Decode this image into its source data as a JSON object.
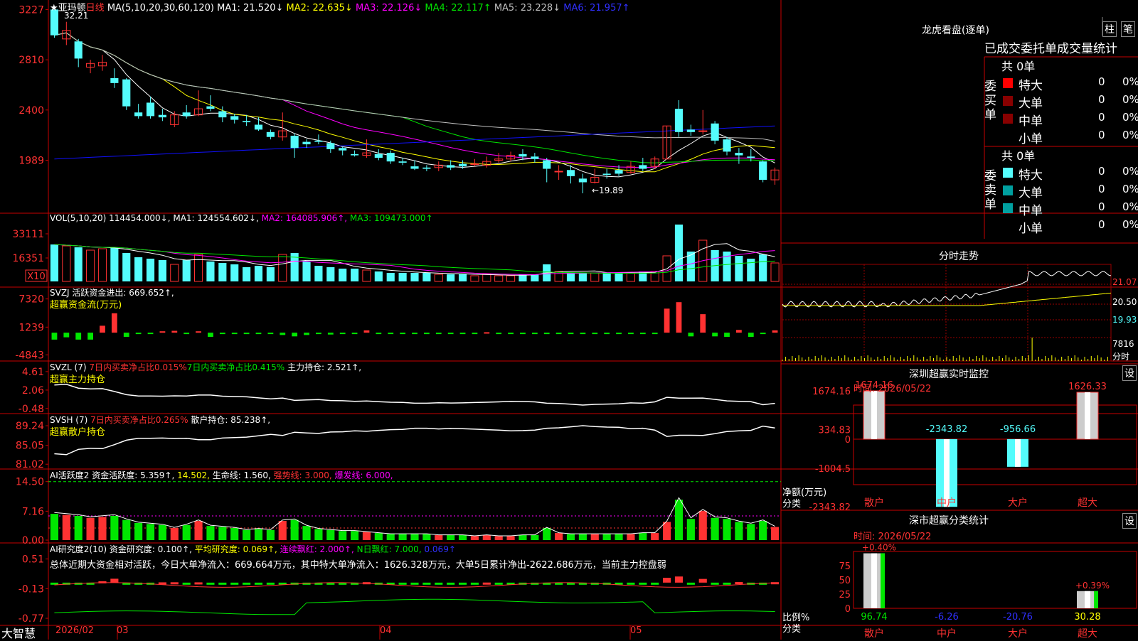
{
  "colors": {
    "up": "#ff3232",
    "down": "#54fcfc",
    "grid": "#9a0000",
    "axis": "#c80000",
    "ma1": "#ffffff",
    "ma2": "#ffff00",
    "ma3": "#ff00ff",
    "ma4": "#00e600",
    "ma5": "#c0c0c0",
    "ma6": "#1010ff",
    "green": "#00e600",
    "yellow": "#ffff00"
  },
  "header": {
    "stock": "★亚玛顿",
    "period": "日线",
    "ma_label": "MA(5,10,20,30,60,120)",
    "ma1": "MA1: 21.520↓",
    "ma2": "MA2: 22.635↓",
    "ma3": "MA3: 22.126↓",
    "ma4": "MA4: 22.117↑",
    "ma5": "MA5: 23.228↓",
    "ma6": "MA6: 21.957↑",
    "hi_note": "32.21",
    "lo_note": "←19.89"
  },
  "price_axis": [
    "3227",
    "2810",
    "2400",
    "1989"
  ],
  "vol": {
    "label": "VOL(5,10,20)",
    "val": "114454.000↓,",
    "ma1": "MA1: 124554.602↓,",
    "ma2": "MA2: 164085.906↑,",
    "ma3": "MA3: 109473.000↑",
    "axis": [
      "33111",
      "16351"
    ],
    "unit": "X10"
  },
  "svzj": {
    "label": "SVZJ  活跃资金进出: 669.652↑,",
    "sub": "超赢资金流(万元)",
    "axis": [
      "7320",
      "1239",
      "-4843"
    ]
  },
  "svzl": {
    "label": "SVZL (7)",
    "a": "7日内买卖净占比0.015%",
    "b": "7日内买卖净占比0.415%",
    "c": "主力持仓: 2.521↑,",
    "sub": "超赢主力持仓",
    "axis": [
      "4.61",
      "2.06",
      "-0.48"
    ]
  },
  "svsh": {
    "label": "SVSH (7)",
    "a": "7日内买卖净占比0.265%",
    "c": "散户持仓: 85.238↑,",
    "sub": "超赢散户持仓",
    "axis": [
      "89.24",
      "85.05",
      "81.02"
    ]
  },
  "ai1": {
    "label": "AI活跃度2",
    "a": "资金活跃度: 5.359↑,",
    "b": "14.502,",
    "c": "生命线: 1.560,",
    "d": "强势线: 3.000,",
    "e": "爆发线: 6.000,",
    "axis": [
      "14.50",
      "7.16",
      "0.00"
    ]
  },
  "ai2": {
    "label": "AI研究度2(10)",
    "a": "资金研究度: 0.100↑,",
    "b": "平均研究度: 0.069↑,",
    "c": "连续飘红: 2.000↑,",
    "d": "N日飘红: 7.000,",
    "e": "0.069↑",
    "summary": "总体近期大资金相对活跃，今日大单净流入：669.664万元，其中特大单净流入：1626.328万元，大单5日累计净出-2622.686万元，当前主力控盘弱",
    "axis": [
      "0.51",
      "-0.13",
      "-0.77"
    ]
  },
  "xaxis": {
    "logo": "大智慧",
    "d1": "2026/02",
    "d2": "03",
    "d3": "04",
    "d4": "05"
  },
  "right": {
    "title": "龙虎看盘(逐单)",
    "btn1": "柱",
    "btn2": "笔",
    "subtitle": "已成交委托单成交量统计",
    "buy_side": "委买单",
    "sell_side": "委卖单",
    "buy_total": "共 0单",
    "sell_total": "共 0单",
    "rows": [
      {
        "name": "特大",
        "v": "0",
        "p": "0%"
      },
      {
        "name": "大单",
        "v": "0",
        "p": "0%"
      },
      {
        "name": "中单",
        "v": "0",
        "p": "0%"
      },
      {
        "name": "小单",
        "v": "0",
        "p": "0%"
      }
    ],
    "fenshi": "分时走势",
    "fs_axis": [
      "21.07",
      "20.50",
      "19.93",
      "7816"
    ],
    "fs_unit": "分时",
    "monitor": "深圳超赢实时监控",
    "settings": "设",
    "date": "时间: 2026/05/22",
    "m_axis": [
      "1674.16",
      "334.83",
      "0",
      "-1004.5",
      "-2343.82"
    ],
    "m_unit": "净额(万元)",
    "cat_label": "分类",
    "cats": [
      "散户",
      "中户",
      "大户",
      "超大"
    ],
    "m_vals": [
      {
        "v": 1674.16,
        "t": "1674.16"
      },
      {
        "v": -2343.82,
        "t": "-2343.82"
      },
      {
        "v": -956.66,
        "t": "-956.66"
      },
      {
        "v": 1626.33,
        "t": "1626.33"
      }
    ],
    "stats": "深市超赢分类统计",
    "s_axis": [
      "75",
      "50",
      "25",
      "0"
    ],
    "s_unit": "比例%",
    "s_vals": [
      {
        "v": 96.74,
        "t": "96.74",
        "top": "+0.40%"
      },
      {
        "v": -6.26,
        "t": "-6.26",
        "top": ""
      },
      {
        "v": -20.76,
        "t": "-20.76",
        "top": ""
      },
      {
        "v": 30.28,
        "t": "30.28",
        "top": "+0.39%"
      }
    ]
  },
  "chart_data": {
    "type": "candlestick",
    "ylim": [
      19.89,
      32.21
    ],
    "candles": [
      [
        32.2,
        30.1,
        32.2,
        29.9
      ],
      [
        29.8,
        30.5,
        31.2,
        29.3
      ],
      [
        29.6,
        28.2,
        29.8,
        27.5
      ],
      [
        27.5,
        27.8,
        28.1,
        27.0
      ],
      [
        27.6,
        27.9,
        28.5,
        27.2
      ],
      [
        26.6,
        26.2,
        27.4,
        25.8
      ],
      [
        26.5,
        24.3,
        26.6,
        24.0
      ],
      [
        23.8,
        23.5,
        24.5,
        23.3
      ],
      [
        24.6,
        23.5,
        25.1,
        23.3
      ],
      [
        23.6,
        23.4,
        24.1,
        23.1
      ],
      [
        22.8,
        23.6,
        23.9,
        22.6
      ],
      [
        23.8,
        23.5,
        24.4,
        23.3
      ],
      [
        23.6,
        24.1,
        25.6,
        23.5
      ],
      [
        24.3,
        24.1,
        25.2,
        23.9
      ],
      [
        23.9,
        23.4,
        24.3,
        23.0
      ],
      [
        23.5,
        23.2,
        23.7,
        22.9
      ],
      [
        23.1,
        23.0,
        23.6,
        22.7
      ],
      [
        22.8,
        22.4,
        23.4,
        22.3
      ],
      [
        22.2,
        21.8,
        22.4,
        21.6
      ],
      [
        21.8,
        22.3,
        23.8,
        21.5
      ],
      [
        21.9,
        20.9,
        22.1,
        20.1
      ],
      [
        21.4,
        21.2,
        21.6,
        20.9
      ],
      [
        21.5,
        21.4,
        22.0,
        21.2
      ],
      [
        21.3,
        20.8,
        21.5,
        20.5
      ],
      [
        20.9,
        20.7,
        21.0,
        20.3
      ],
      [
        20.4,
        20.3,
        20.7,
        20.2
      ],
      [
        20.3,
        20.5,
        21.6,
        20.1
      ],
      [
        20.4,
        20.1,
        20.8,
        19.9
      ],
      [
        20.5,
        19.8,
        20.7,
        19.6
      ],
      [
        19.8,
        19.7,
        20.1,
        19.5
      ],
      [
        19.4,
        19.2,
        19.9,
        19.1
      ],
      [
        19.3,
        19.2,
        19.5,
        19.0
      ],
      [
        19.3,
        19.5,
        19.8,
        19.0
      ],
      [
        19.5,
        19.3,
        19.9,
        19.1
      ],
      [
        19.6,
        19.4,
        19.9,
        19.2
      ],
      [
        19.6,
        19.6,
        20.0,
        19.4
      ],
      [
        19.5,
        19.8,
        20.2,
        19.3
      ],
      [
        19.9,
        20.0,
        20.5,
        19.7
      ],
      [
        20.0,
        20.3,
        20.6,
        19.8
      ],
      [
        20.4,
        20.2,
        20.8,
        19.9
      ],
      [
        20.2,
        20.0,
        20.5,
        19.7
      ],
      [
        19.9,
        19.2,
        20.1,
        18.1
      ],
      [
        19.0,
        19.0,
        19.5,
        18.3
      ],
      [
        19.1,
        18.6,
        19.5,
        18.0
      ],
      [
        18.4,
        18.1,
        18.8,
        17.2
      ],
      [
        18.1,
        18.5,
        19.2,
        18.0
      ],
      [
        18.8,
        18.7,
        19.2,
        18.4
      ],
      [
        19.1,
        18.8,
        19.5,
        18.6
      ],
      [
        18.9,
        19.4,
        19.8,
        18.8
      ],
      [
        19.5,
        19.2,
        20.1,
        19.0
      ],
      [
        19.4,
        20.0,
        20.2,
        19.2
      ],
      [
        20.0,
        22.7,
        22.7,
        20.0
      ],
      [
        24.1,
        22.2,
        24.8,
        21.8
      ],
      [
        22.4,
        22.2,
        22.8,
        21.9
      ],
      [
        22.3,
        22.3,
        24.0,
        22.0
      ],
      [
        22.9,
        21.5,
        23.1,
        21.2
      ],
      [
        21.6,
        20.6,
        21.8,
        20.3
      ],
      [
        20.5,
        20.3,
        20.9,
        19.6
      ],
      [
        20.2,
        20.1,
        20.8,
        19.8
      ],
      [
        19.8,
        18.3,
        19.9,
        18.1
      ],
      [
        18.3,
        19.1,
        19.3,
        17.9
      ]
    ],
    "volume": [
      2.6,
      2.5,
      2.4,
      2.2,
      2.3,
      2.4,
      2.0,
      1.7,
      1.6,
      1.5,
      1.2,
      1.5,
      1.9,
      1.4,
      1.3,
      1.2,
      1.0,
      1.1,
      1.0,
      1.9,
      2.0,
      1.4,
      1.1,
      1.0,
      0.9,
      0.9,
      0.8,
      0.7,
      0.6,
      0.6,
      0.6,
      0.6,
      0.5,
      0.5,
      0.5,
      0.4,
      0.5,
      0.4,
      0.4,
      0.5,
      0.5,
      1.2,
      0.7,
      0.6,
      0.6,
      0.6,
      0.6,
      0.6,
      0.6,
      0.7,
      0.7,
      1.8,
      4.0,
      2.1,
      2.9,
      2.2,
      2.1,
      1.8,
      1.6,
      1.9,
      1.3
    ],
    "svzj": [
      -1.5,
      -1.0,
      -1.5,
      -1.5,
      1.5,
      4.2,
      -0.9,
      -0.3,
      -0.3,
      0.3,
      0.4,
      -0.2,
      0.3,
      -0.9,
      -0.2,
      -0.2,
      -0.2,
      -0.3,
      -0.1,
      -0.5,
      -0.8,
      -0.5,
      -0.3,
      -0.4,
      -0.3,
      -0.2,
      0.5,
      -0.1,
      -0.1,
      -0.1,
      -0.1,
      -0.1,
      -0.1,
      -0.1,
      -0.1,
      -0.1,
      0.1,
      -0.1,
      -0.1,
      -0.1,
      -0.1,
      -0.2,
      -0.1,
      -0.1,
      -0.1,
      -0.2,
      -0.2,
      -0.2,
      -0.3,
      -0.2,
      -0.1,
      5.2,
      6.6,
      -0.8,
      4.0,
      -0.8,
      -0.9,
      0.6,
      -0.9,
      -0.2,
      0.5
    ]
  }
}
